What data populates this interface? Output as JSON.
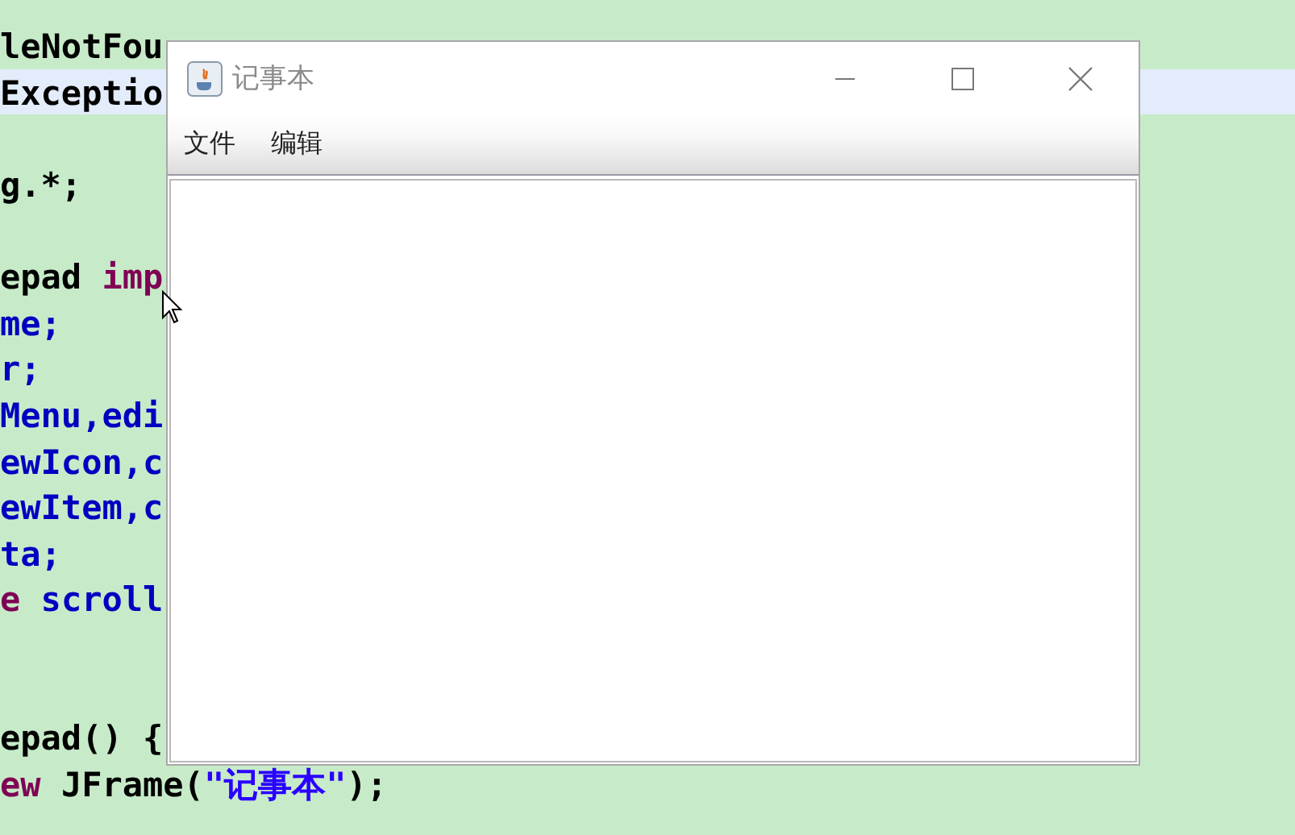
{
  "editor": {
    "lines": [
      {
        "tokens": [
          {
            "text": "leNotFou",
            "kind": "plain"
          }
        ],
        "highlighted": false
      },
      {
        "tokens": [
          {
            "text": "Exceptio",
            "kind": "plain"
          }
        ],
        "highlighted": true
      },
      {
        "highlighted": false
      },
      {
        "tokens": [
          {
            "text": "g.*;",
            "kind": "plain"
          }
        ],
        "highlighted": false
      },
      {
        "highlighted": false
      },
      {
        "tokens": [
          {
            "text": "epad ",
            "kind": "plain"
          },
          {
            "text": "imp",
            "kind": "keyword"
          }
        ],
        "highlighted": false
      },
      {
        "tokens": [
          {
            "text": "me;",
            "kind": "field"
          }
        ],
        "highlighted": false
      },
      {
        "tokens": [
          {
            "text": "r;",
            "kind": "field"
          }
        ],
        "highlighted": false
      },
      {
        "tokens": [
          {
            "text": "Menu,edi",
            "kind": "field"
          }
        ],
        "highlighted": false
      },
      {
        "tokens": [
          {
            "text": "ewIcon,c",
            "kind": "field"
          }
        ],
        "highlighted": false
      },
      {
        "tokens": [
          {
            "text": "ewItem,c",
            "kind": "field"
          }
        ],
        "highlighted": false
      },
      {
        "tokens": [
          {
            "text": "ta;",
            "kind": "field"
          }
        ],
        "highlighted": false
      },
      {
        "tokens": [
          {
            "text": "e ",
            "kind": "keyword"
          },
          {
            "text": "scroll",
            "kind": "field"
          }
        ],
        "highlighted": false
      },
      {
        "highlighted": false
      },
      {
        "highlighted": false
      },
      {
        "tokens": [
          {
            "text": "epad() {",
            "kind": "plain"
          }
        ],
        "highlighted": false
      },
      {
        "tokens": [
          {
            "text": "ew",
            "kind": "keyword"
          },
          {
            "text": " JFrame(",
            "kind": "plain"
          },
          {
            "text": "\"记事本\"",
            "kind": "string"
          },
          {
            "text": ");",
            "kind": "plain"
          }
        ],
        "highlighted": false
      }
    ]
  },
  "window": {
    "title": "记事本",
    "menu": [
      {
        "label": "文件"
      },
      {
        "label": "编辑"
      }
    ]
  }
}
